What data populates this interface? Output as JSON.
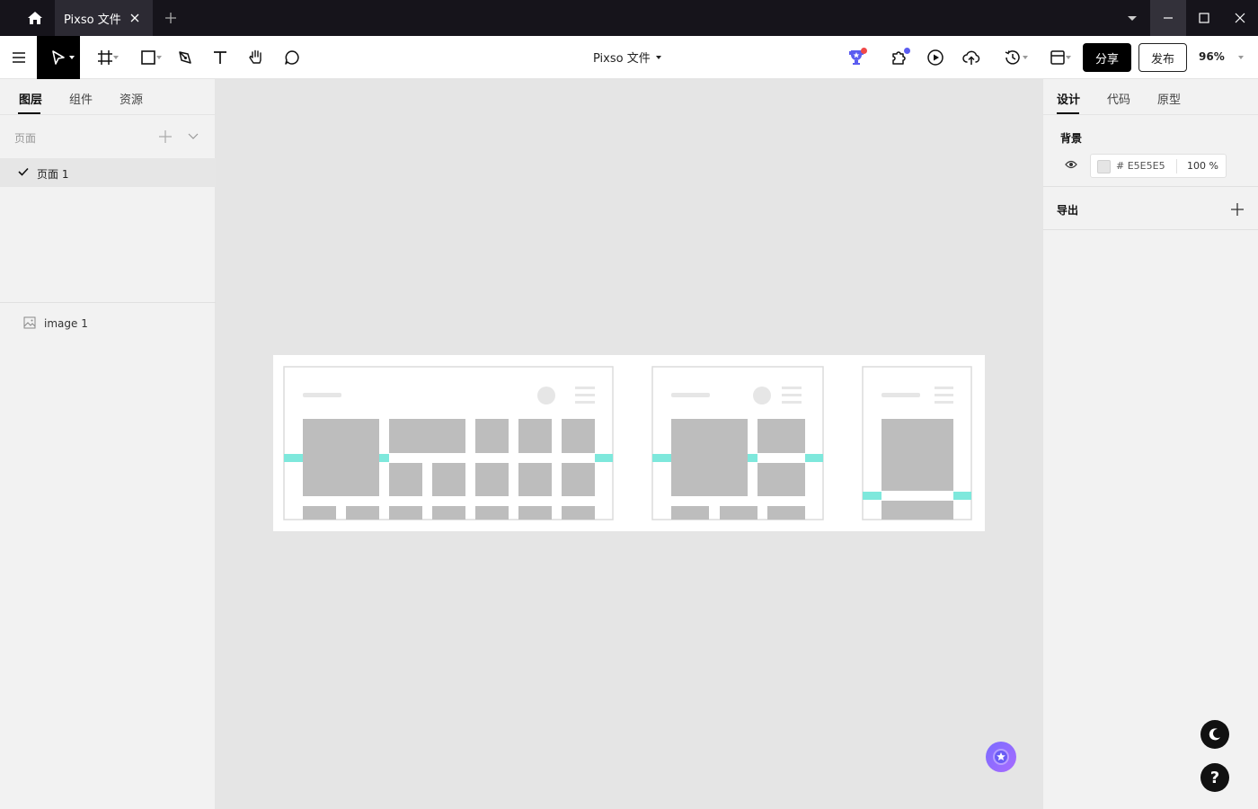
{
  "titlebar": {
    "tab_title": "Pixso 文件",
    "icons": [
      "home-icon",
      "close-icon",
      "plus-icon",
      "chevron-down-icon",
      "minimize-icon",
      "maximize-icon",
      "window-close-icon"
    ]
  },
  "toolbar": {
    "doc_title": "Pixso 文件",
    "share_label": "分享",
    "publish_label": "发布",
    "zoom": "96%",
    "tools": [
      "menu-icon",
      "move-icon",
      "frame-icon",
      "shape-icon",
      "pen-icon",
      "text-icon",
      "hand-icon",
      "comment-icon"
    ]
  },
  "left": {
    "tabs": [
      "图层",
      "组件",
      "资源"
    ],
    "pages_header": "页面",
    "pages": [
      "页面 1"
    ],
    "layers": [
      "image 1"
    ]
  },
  "right": {
    "tabs": [
      "设计",
      "代码",
      "原型"
    ],
    "background_title": "背景",
    "hex_prefix": "#",
    "hex": "E5E5E5",
    "opacity": "100 %",
    "export_title": "导出",
    "help_label": "?"
  },
  "colors": {
    "titlebar_bg": "#16141b",
    "canvas_bg": "#E5E5E5",
    "accent_teal": "#7ee8dc",
    "placeholder_gray": "#bdbdbd"
  }
}
